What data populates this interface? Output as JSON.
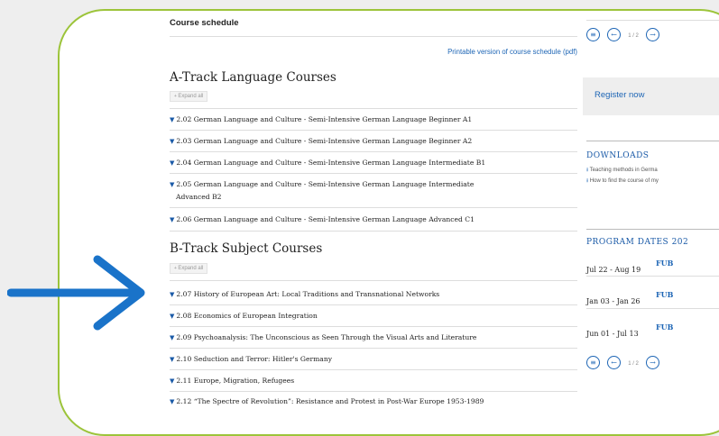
{
  "main": {
    "title": "Course schedule",
    "printable_link": "Printable version of course schedule (pdf)",
    "section_a": {
      "title": "A-Track Language Courses",
      "expand_label": "Expand all",
      "courses": [
        "2.02 German Language and Culture - Semi-Intensive German Language Beginner A1",
        "2.03 German Language and Culture - Semi-Intensive German Language Beginner A2",
        "2.04 German Language and Culture - Semi-Intensive German Language Intermediate B1",
        "2.05 German Language and Culture - Semi-Intensive German Language Intermediate",
        "Advanced B2",
        "2.06 German Language and Culture - Semi-Intensive German Language Advanced C1"
      ]
    },
    "section_b": {
      "title": "B-Track Subject Courses",
      "expand_label": "Expand all",
      "courses": [
        "2.07 History of European Art: Local Traditions and Transnational Networks",
        "2.08 Economics of European Integration",
        "2.09 Psychoanalysis: The Unconscious as Seen Through the Visual Arts and Literature",
        "2.10 Seduction and Terror: Hitler's Germany",
        "2.11 Europe, Migration, Refugees",
        "2.12 “The Spectre of Revolution”: Resistance and Protest in Post-War Europe 1953-1989"
      ]
    }
  },
  "sidebar": {
    "pager": {
      "menu_icon": "menu-icon",
      "prev_icon": "arrow-left-icon",
      "next_icon": "arrow-right-icon",
      "label": "1 / 2"
    },
    "register_label": "Register now",
    "downloads": {
      "title": "DOWNLOADS",
      "items": [
        "Teaching methods in Germa",
        "How to find the course of my"
      ]
    },
    "program_dates": {
      "title": "PROGRAM DATES 202",
      "rows": [
        {
          "dates": "Jul 22 - Aug 19",
          "code": "FUB"
        },
        {
          "dates": "Jan 03 - Jan 26",
          "code": "FUB"
        },
        {
          "dates": "Jun 01 - Jul 13",
          "code": "FUB"
        }
      ]
    }
  },
  "annotation": {
    "arrow_icon": "arrow-right-icon",
    "color": "#1a73c9"
  },
  "colors": {
    "frame": "#9cc43a",
    "link": "#1d65b5",
    "background": "#eeeeee"
  }
}
